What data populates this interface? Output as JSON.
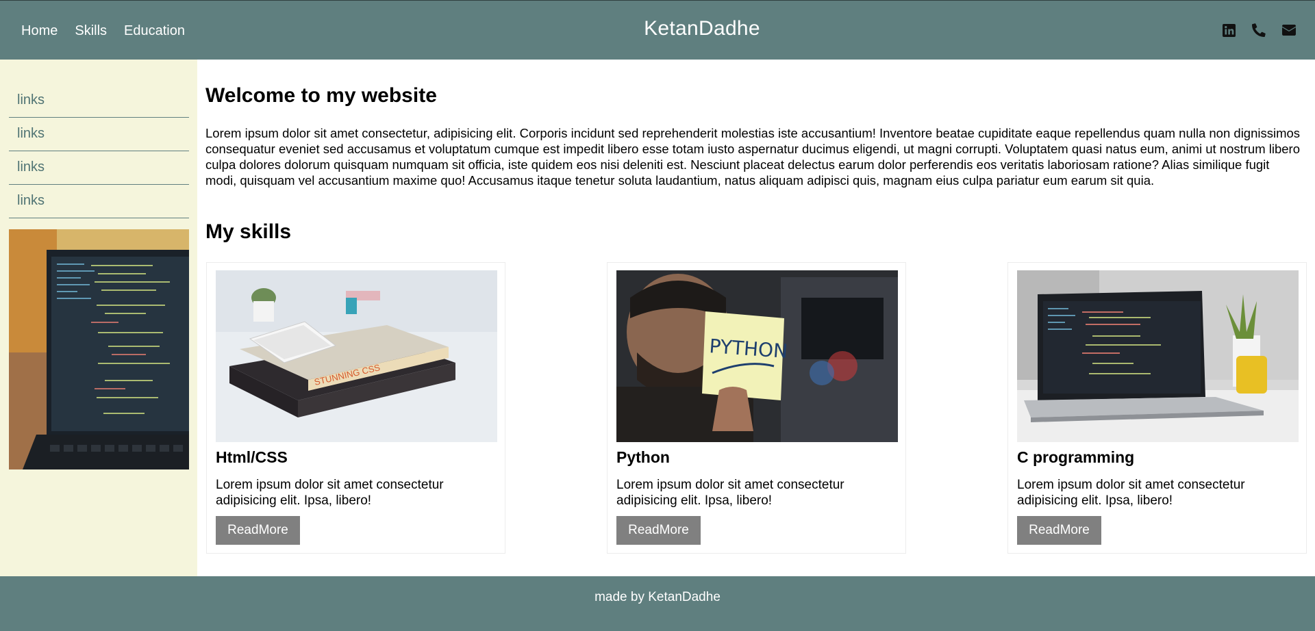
{
  "nav": {
    "links": [
      "Home",
      "Skills",
      "Education"
    ],
    "brand": "KetanDadhe",
    "social_icons": [
      "linkedin-icon",
      "phone-icon",
      "mail-icon"
    ]
  },
  "sidebar": {
    "links": [
      "links",
      "links",
      "links",
      "links"
    ],
    "image": "laptop-code-photo"
  },
  "main": {
    "welcome_title": "Welcome to my website",
    "intro": "Lorem ipsum dolor sit amet consectetur, adipisicing elit. Corporis incidunt sed reprehenderit molestias iste accusantium! Inventore beatae cupiditate eaque repellendus quam nulla non dignissimos consequatur eveniet sed accusamus et voluptatum cumque est impedit libero esse totam iusto aspernatur ducimus eligendi, ut magni corrupti. Voluptatem quasi natus eum, animi ut nostrum libero culpa dolores dolorum quisquam numquam sit officia, iste quidem eos nisi deleniti est. Nesciunt placeat delectus earum dolor perferendis eos veritatis laboriosam ratione? Alias similique fugit modi, quisquam vel accusantium maxime quo! Accusamus itaque tenetur soluta laudantium, natus aliquam adipisci quis, magnam eius culpa pariatur eum earum sit quia.",
    "skills_title": "My skills",
    "cards": [
      {
        "title": "Html/CSS",
        "desc": "Lorem ipsum dolor sit amet consectetur adipisicing elit. Ipsa, libero!",
        "button": "ReadMore",
        "image": "books-phone-photo"
      },
      {
        "title": "Python",
        "desc": "Lorem ipsum dolor sit amet consectetur adipisicing elit. Ipsa, libero!",
        "button": "ReadMore",
        "image": "python-sticky-note-photo",
        "note_text": "PYTHON"
      },
      {
        "title": "C programming",
        "desc": "Lorem ipsum dolor sit amet consectetur adipisicing elit. Ipsa, libero!",
        "button": "ReadMore",
        "image": "laptop-desk-photo"
      }
    ]
  },
  "footer": {
    "text": "made by KetanDadhe"
  },
  "colors": {
    "header_bg": "#5f7f7f",
    "sidebar_bg": "#f5f5dc",
    "button_bg": "#808080"
  }
}
